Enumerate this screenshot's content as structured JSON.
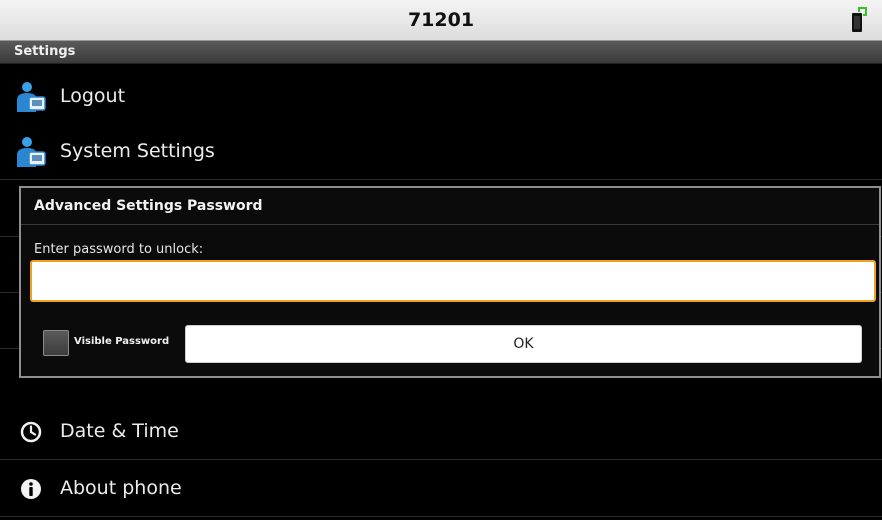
{
  "status_bar": {
    "title": "71201",
    "device_icon": "phone-battery-icon"
  },
  "header": {
    "title": "Settings"
  },
  "menu": {
    "items": [
      {
        "label": "Logout",
        "icon": "user-device-icon"
      },
      {
        "label": "System Settings",
        "icon": "user-device-icon"
      },
      {
        "label": "Date & Time",
        "icon": "clock-icon"
      },
      {
        "label": "About phone",
        "icon": "info-icon"
      }
    ]
  },
  "dialog": {
    "title": "Advanced Settings Password",
    "prompt": "Enter password to unlock:",
    "password_value": "",
    "visible_password_label": "Visible Password",
    "visible_password_checked": false,
    "ok_label": "OK",
    "accent_color": "#f0a21f"
  }
}
